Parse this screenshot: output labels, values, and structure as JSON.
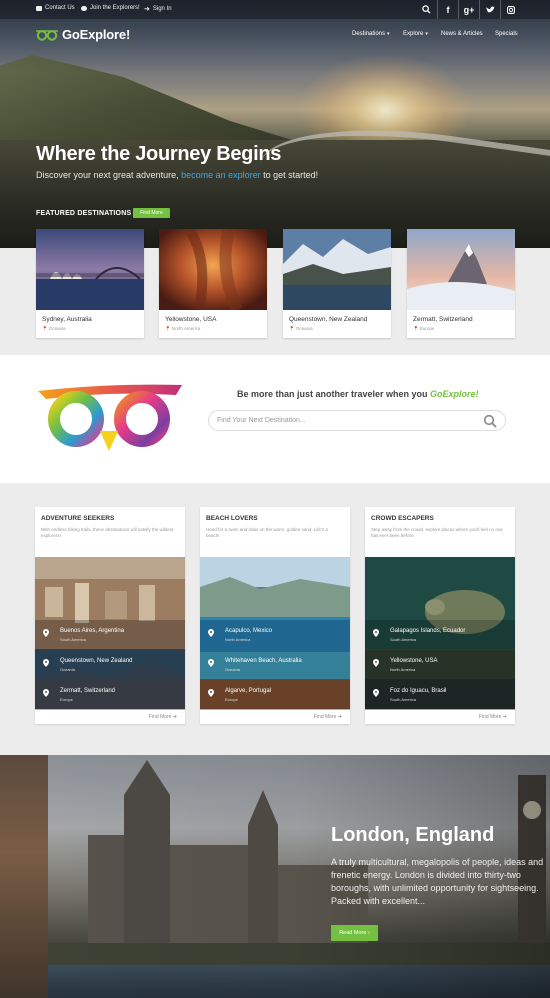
{
  "topbar": {
    "links": [
      "Contact Us",
      "Join the Explorers!",
      "Sign In"
    ],
    "social": [
      "search-icon",
      "facebook-icon",
      "google-plus-icon",
      "twitter-icon",
      "instagram-icon"
    ]
  },
  "brand": {
    "name_prefix": "Go",
    "name_suffix": "Explore!",
    "accent": "#74c043"
  },
  "nav": {
    "items": [
      "Destinations",
      "Explore",
      "News & Articles",
      "Specials"
    ],
    "caret": "▾"
  },
  "hero": {
    "title": "Where the Journey Begins",
    "subtitle_before": "Discover your next great adventure, ",
    "subtitle_link": "become an explorer",
    "subtitle_after": " to get started!"
  },
  "featured": {
    "label": "FEATURED DESTINATIONS",
    "button": "Find More",
    "cards": [
      {
        "name": "Sydney, Australia",
        "region": "Oceania"
      },
      {
        "name": "Yellowstone, USA",
        "region": "North America"
      },
      {
        "name": "Queenstown, New Zealand",
        "region": "Oceania"
      },
      {
        "name": "Zermatt, Switzerland",
        "region": "Europe"
      }
    ]
  },
  "search": {
    "tagline_before": "Be more than just another traveler when you ",
    "tagline_brand": "GoExplore!",
    "placeholder": "Find Your Next Destination..."
  },
  "categories": [
    {
      "title": "ADVENTURE SEEKERS",
      "desc": "With endless hiking trails, these destinations will satisfy the wildest explorers!",
      "rows": [
        {
          "name": "Buenos Aires, Argentina",
          "region": "South America"
        },
        {
          "name": "Queenstown, New Zealand",
          "region": "Oceania"
        },
        {
          "name": "Zermatt, Switzerland",
          "region": "Europe"
        }
      ],
      "more": "Find More"
    },
    {
      "title": "BEACH LOVERS",
      "desc": "Head for a swim and relax on the warm, golden sand. Life's a beach!",
      "rows": [
        {
          "name": "Acapulco, Mexico",
          "region": "North America"
        },
        {
          "name": "Whitehaven Beach, Australia",
          "region": "Oceania"
        },
        {
          "name": "Algarve, Portugal",
          "region": "Europe"
        }
      ],
      "more": "Find More"
    },
    {
      "title": "CROWD ESCAPERS",
      "desc": "Step away from the crowd, explore places where you'll feel no one has ever been before.",
      "rows": [
        {
          "name": "Galapagos Islands, Ecuador",
          "region": "South America"
        },
        {
          "name": "Yellowstone, USA",
          "region": "North America"
        },
        {
          "name": "Foz do Iguacu, Brasil",
          "region": "South America"
        }
      ],
      "more": "Find More"
    }
  ],
  "spotlight": {
    "title": "London, England",
    "desc": "A truly multicultural, megalopolis of people, ideas and frenetic energy. London is divided into thirty-two boroughs, with unlimited opportunity for sightseeing. Packed with excellent...",
    "button": "Read More"
  }
}
